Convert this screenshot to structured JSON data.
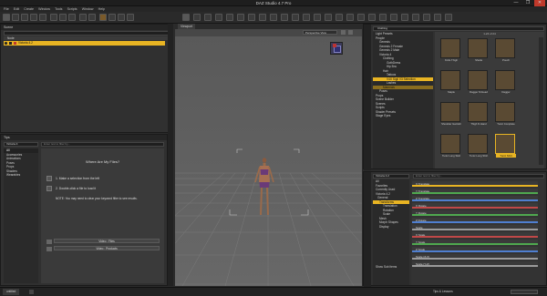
{
  "window": {
    "title": "DAZ Studio 4.7 Pro",
    "minimize": "—",
    "maximize": "❐",
    "close": "✕"
  },
  "menu": [
    "File",
    "Edit",
    "Create",
    "Window",
    "Tools",
    "Scripts",
    "Window",
    "Help"
  ],
  "scene": {
    "tab_label": "Scene",
    "header_label": "Node",
    "selected_node": "Victoria 4.2"
  },
  "tips": {
    "tab_label": "Tips",
    "dropdown_value": "Victoria 4",
    "search_placeholder": "Enter text to filter by...",
    "category_all": "All",
    "categories": [
      "Accessories",
      "Animations",
      "Poses",
      "Props",
      "Shaders",
      "Wearables"
    ],
    "heading": "Where Are My Files?",
    "step1": "1.  Make a selection from the left",
    "step2": "2.  Double-click a file to load it",
    "note": "NOTE: You may need to clear your keyword filter to see results.",
    "btn_video": "Video : Files",
    "btn_video2": "Video : Products"
  },
  "viewport": {
    "tab_label": "Viewport",
    "camera_dropdown": "Perspective View",
    "nav_cube_label": "TOP"
  },
  "content_library": {
    "search_value": "Clothing",
    "page_label": "1-24 of 24",
    "folders": [
      "Light Presets",
      "People",
      "Genesis",
      "Genesis 2 Female",
      "Genesis 2 Male",
      "Victoria 4",
      "Clothing",
      "GothDress",
      "Hip Bra",
      "Hair",
      "Tattoos",
      "V4X Sigil V3 Selection",
      "Lashes",
      "Materials",
      "Poses",
      "Props",
      "Scene Builder",
      "Scenes",
      "Scripts",
      "Shader Presets",
      "Stage Eyes"
    ],
    "selected_folder": "V4X Sigil V3 Selection",
    "items": [
      {
        "label": "Knife Thigh"
      },
      {
        "label": "Sheila"
      },
      {
        "label": "Pouch"
      },
      {
        "label": "Staple"
      },
      {
        "label": "Dagger M Head"
      },
      {
        "label": "Dagger"
      },
      {
        "label": "Shoulder Garnish"
      },
      {
        "label": "Thigh N Hand"
      },
      {
        "label": "Tunic Complete"
      },
      {
        "label": "Tunic Long Skirt"
      },
      {
        "label": "Tunic Long Shirt"
      },
      {
        "label": "Tunic Shirt"
      }
    ]
  },
  "parameters": {
    "dropdown_value": "Victoria 4.2",
    "search_placeholder": "Enter text to filter by...",
    "tree": [
      "All",
      "Favorites",
      "Currently Used",
      "Victoria 4.2",
      "General",
      "Transforms",
      "Translation",
      "Rotation",
      "Scale",
      "Mesh",
      "Morph Shapes",
      "Display"
    ],
    "selected_tree": "Transforms",
    "tree_footer": "Show Sub Items",
    "sliders": [
      {
        "label": "X Translate",
        "value": "0.00 cm",
        "color": "#e8b423"
      },
      {
        "label": "Y Translate",
        "value": "0.00 cm",
        "color": "#4fa84f"
      },
      {
        "label": "Z Translate",
        "value": "0.00 cm",
        "color": "#4f7fd0"
      },
      {
        "label": "X Rotate",
        "value": "0.00",
        "color": "#c04848"
      },
      {
        "label": "Y Rotate",
        "value": "0.00",
        "color": "#4fa84f"
      },
      {
        "label": "Z Rotate",
        "value": "0.00",
        "color": "#4f7fd0"
      },
      {
        "label": "Scale",
        "value": "100%",
        "color": "#9b9b9b"
      },
      {
        "label": "X Scale",
        "value": "100%",
        "color": "#c04848"
      },
      {
        "label": "Y Scale",
        "value": "100%",
        "color": "#4fa84f"
      },
      {
        "label": "Z Scale",
        "value": "100%",
        "color": "#4f7fd0"
      },
      {
        "label": "Scale (Z-X)",
        "value": "100%",
        "color": "#9b9b9b"
      },
      {
        "label": "Scale (Y-Z)",
        "value": "100%",
        "color": "#9b9b9b"
      }
    ]
  },
  "status": {
    "left_tab": "untitled",
    "right_text": "Tips & Lessons"
  }
}
